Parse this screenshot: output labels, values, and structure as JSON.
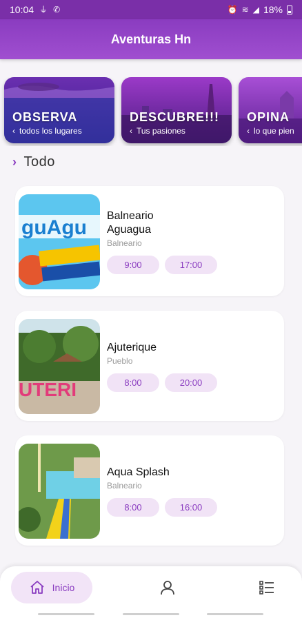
{
  "status_bar": {
    "time": "10:04",
    "battery": "18%",
    "icons": [
      "usb-icon",
      "phone-icon",
      "alarm-icon",
      "wifi-icon",
      "signal-icon",
      "battery-icon"
    ]
  },
  "app_bar": {
    "title": "Aventuras Hn"
  },
  "banners": [
    {
      "title": "OBSERVA",
      "subtitle": "todos los lugares"
    },
    {
      "title": "DESCUBRE!!!",
      "subtitle": "Tus pasiones"
    },
    {
      "title": "OPINA",
      "subtitle": "lo que pien"
    }
  ],
  "section": {
    "title": "Todo"
  },
  "places": [
    {
      "name": "Balneario Aguagua",
      "type": "Balneario",
      "open": "9:00",
      "close": "17:00",
      "logo_text": "guAgu"
    },
    {
      "name": "Ajuterique",
      "type": "Pueblo",
      "open": "8:00",
      "close": "20:00",
      "sign_text": "UTERI"
    },
    {
      "name": "Aqua Splash",
      "type": "Balneario",
      "open": "8:00",
      "close": "16:00"
    }
  ],
  "bottom_nav": {
    "home_label": "Inicio",
    "items": [
      "home-icon",
      "profile-icon",
      "list-icon"
    ]
  },
  "colors": {
    "primary": "#8a3cc0",
    "pill_bg": "#f1e3f6"
  }
}
